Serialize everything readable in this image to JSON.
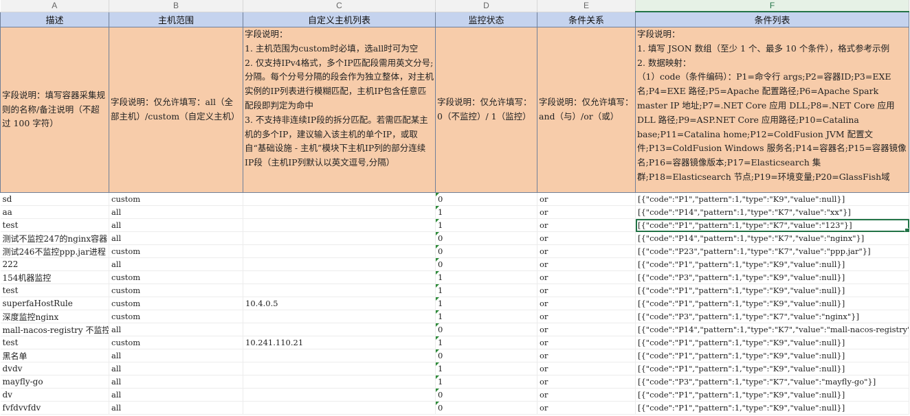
{
  "column_letters": [
    "A",
    "B",
    "C",
    "D",
    "E",
    "F"
  ],
  "headers": [
    "描述",
    "主机范围",
    "自定义主机列表",
    "监控状态",
    "条件关系",
    "条件列表"
  ],
  "descriptions": {
    "a": "字段说明：填写容器采集规则的名称/备注说明（不超过 100 字符）",
    "b": "字段说明：仅允许填写：all（全部主机）/custom（自定义主机）",
    "c": "字段说明：\n1. 主机范围为custom时必填，选all时可为空\n2. 仅支持IPv4格式，多个IP匹配段需用英文分号;分隔。每个分号分隔的段会作为独立整体，对主机实例的IP列表进行模糊匹配，主机IP包含任意匹配段即判定为命中\n3. 不支持非连续IP段的拆分匹配。若需匹配某主机的多个IP，建议输入该主机的单个IP，或取自“基础设施 - 主机”模块下主机IP列的部分连续IP段（主机IP列默认以英文逗号,分隔）",
    "d": "字段说明：仅允许填写：0（不监控）/ 1（监控）",
    "e": "字段说明：仅允许填写：and（与）/or（或）",
    "f": "字段说明：\n1. 填写 JSON 数组（至少 1 个、最多 10 个条件），格式参考示例\n2. 数据映射：\n（1）code（条件编码）：P1=命令行 args;P2=容器ID;P3=EXE 名;P4=EXE 路径;P5=Apache 配置路径;P6=Apache Spark master IP 地址;P7=.NET Core 应用 DLL;P8=.NET Core 应用 DLL 路径;P9=ASP.NET Core 应用路径;P10=Catalina base;P11=Catalina home;P12=ColdFusion JVM 配置文件;P13=ColdFusion Windows 服务名;P14=容器名;P15=容器镜像名;P16=容器镜像版本;P17=Elasticsearch 集群;P18=Elasticsearch 节点;P19=环境变量;P20=GlassFish域"
  },
  "rows": [
    {
      "a": "sd",
      "b": "custom",
      "c": "",
      "d": "0",
      "e": "or",
      "f": "[{\"code\":\"P1\",\"pattern\":1,\"type\":\"K9\",\"value\":null}]"
    },
    {
      "a": "aa",
      "b": "all",
      "c": "",
      "d": "1",
      "e": "or",
      "f": "[{\"code\":\"P14\",\"pattern\":1,\"type\":\"K7\",\"value\":\"xx\"}]"
    },
    {
      "a": "test",
      "b": "all",
      "c": "",
      "d": "1",
      "e": "or",
      "f": "[{\"code\":\"P1\",\"pattern\":1,\"type\":\"K7\",\"value\":\"123\"}]"
    },
    {
      "a": "测试不监控247的nginx容器",
      "b": "all",
      "c": "",
      "d": "0",
      "e": "or",
      "f": "[{\"code\":\"P14\",\"pattern\":1,\"type\":\"K7\",\"value\":\"nginx\"}]"
    },
    {
      "a": "测试246不监控ppp.jar进程",
      "b": "custom",
      "c": "",
      "d": "0",
      "e": "or",
      "f": "[{\"code\":\"P23\",\"pattern\":1,\"type\":\"K7\",\"value\":\"ppp.jar\"}]"
    },
    {
      "a": "222",
      "b": "all",
      "c": "",
      "d": "0",
      "e": "or",
      "f": "[{\"code\":\"P1\",\"pattern\":1,\"type\":\"K9\",\"value\":null}]"
    },
    {
      "a": "154机器监控",
      "b": "custom",
      "c": "",
      "d": "1",
      "e": "or",
      "f": "[{\"code\":\"P3\",\"pattern\":1,\"type\":\"K9\",\"value\":null}]"
    },
    {
      "a": "test",
      "b": "custom",
      "c": "",
      "d": "1",
      "e": "or",
      "f": "[{\"code\":\"P1\",\"pattern\":1,\"type\":\"K9\",\"value\":null}]"
    },
    {
      "a": "superfaHostRule",
      "b": "custom",
      "c": "10.4.0.5",
      "d": "1",
      "e": "or",
      "f": "[{\"code\":\"P1\",\"pattern\":1,\"type\":\"K9\",\"value\":null}]"
    },
    {
      "a": "深度监控nginx",
      "b": "custom",
      "c": "",
      "d": "1",
      "e": "or",
      "f": "[{\"code\":\"P3\",\"pattern\":1,\"type\":\"K7\",\"value\":\"nginx\"}]"
    },
    {
      "a": "mall-nacos-registry 不监控",
      "b": "all",
      "c": "",
      "d": "0",
      "e": "or",
      "f": "[{\"code\":\"P14\",\"pattern\":1,\"type\":\"K7\",\"value\":\"mall-nacos-registry\"}]"
    },
    {
      "a": "test",
      "b": "custom",
      "c": "10.241.110.21",
      "d": "1",
      "e": "or",
      "f": "[{\"code\":\"P1\",\"pattern\":1,\"type\":\"K9\",\"value\":null}]"
    },
    {
      "a": "黑名单",
      "b": "all",
      "c": "",
      "d": "0",
      "e": "or",
      "f": "[{\"code\":\"P1\",\"pattern\":1,\"type\":\"K9\",\"value\":null}]"
    },
    {
      "a": "dvdv",
      "b": "all",
      "c": "",
      "d": "1",
      "e": "or",
      "f": "[{\"code\":\"P1\",\"pattern\":1,\"type\":\"K9\",\"value\":null}]"
    },
    {
      "a": "mayfly-go",
      "b": "all",
      "c": "",
      "d": "1",
      "e": "or",
      "f": "[{\"code\":\"P3\",\"pattern\":1,\"type\":\"K7\",\"value\":\"mayfly-go\"}]"
    },
    {
      "a": "dv",
      "b": "all",
      "c": "",
      "d": "0",
      "e": "or",
      "f": "[{\"code\":\"P1\",\"pattern\":1,\"type\":\"K9\",\"value\":null}]"
    },
    {
      "a": "fvfdvvfdv",
      "b": "all",
      "c": "",
      "d": "0",
      "e": "or",
      "f": "[{\"code\":\"P1\",\"pattern\":1,\"type\":\"K9\",\"value\":null}]"
    }
  ],
  "selected_cell": "F4",
  "accent_color": "#217346",
  "header_color": "#c5d3ee",
  "description_color": "#f7ccaa"
}
